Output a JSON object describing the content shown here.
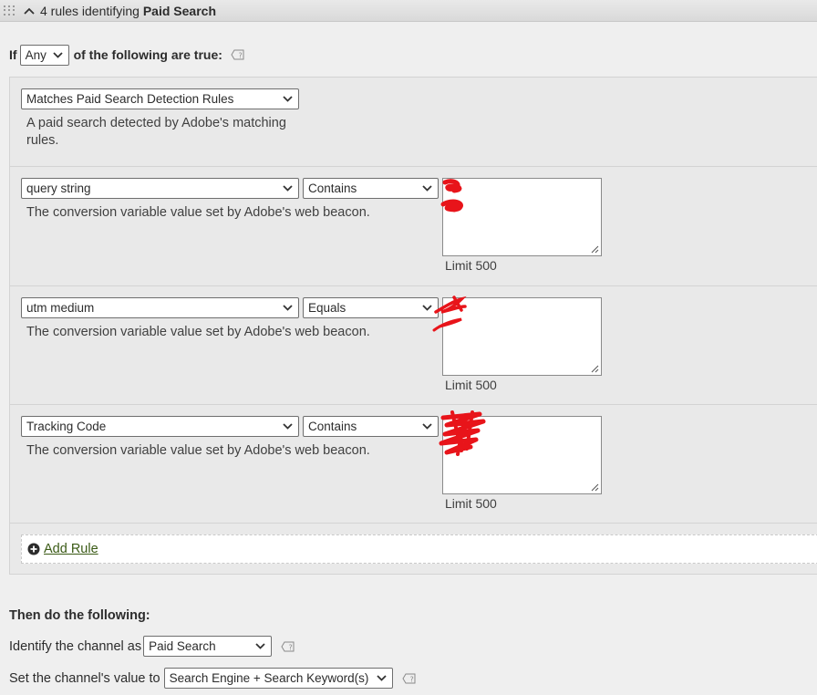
{
  "header": {
    "prefix": "4 rules identifying",
    "channel": "Paid Search"
  },
  "condition": {
    "if_label": "If",
    "match_value": "Any",
    "suffix": "of the following are true:"
  },
  "rules": [
    {
      "field": "Matches Paid Search Detection Rules",
      "description_line1": "A paid search detected by Adobe's matching",
      "description_line2": "rules."
    },
    {
      "field": "query string",
      "operator": "Contains",
      "description": "The conversion variable value set by Adobe's web beacon.",
      "limit": "Limit 500"
    },
    {
      "field": "utm medium",
      "operator": "Equals",
      "description": "The conversion variable value set by Adobe's web beacon.",
      "limit": "Limit 500"
    },
    {
      "field": "Tracking Code",
      "operator": "Contains",
      "description": "The conversion variable value set by Adobe's web beacon.",
      "limit": "Limit 500"
    }
  ],
  "add_rule_label": "Add Rule",
  "then": {
    "title": "Then do the following:",
    "identify_label": "Identify the channel as",
    "identify_value": "Paid Search",
    "set_label": "Set the channel's value to",
    "set_value": "Search Engine + Search Keyword(s)"
  },
  "colors": {
    "link": "#3a5a15",
    "redaction": "#e8141a"
  }
}
